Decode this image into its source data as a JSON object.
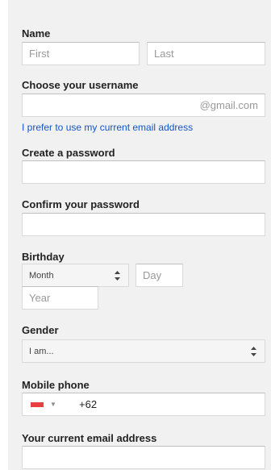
{
  "name": {
    "label": "Name",
    "first_placeholder": "First",
    "last_placeholder": "Last"
  },
  "username": {
    "label": "Choose your username",
    "suffix": "@gmail.com",
    "link": "I prefer to use my current email address"
  },
  "password": {
    "label": "Create a password"
  },
  "confirm": {
    "label": "Confirm your password"
  },
  "birthday": {
    "label": "Birthday",
    "month_selected": "Month",
    "day_placeholder": "Day",
    "year_placeholder": "Year"
  },
  "gender": {
    "label": "Gender",
    "selected": "I am..."
  },
  "mobile": {
    "label": "Mobile phone",
    "country_icon": "flag-icon",
    "value": "+62"
  },
  "current_email": {
    "label": "Your current email address"
  },
  "colors": {
    "link": "#1155cc",
    "panel_bg": "#f1f1f1",
    "flag_red": "#e84040"
  }
}
